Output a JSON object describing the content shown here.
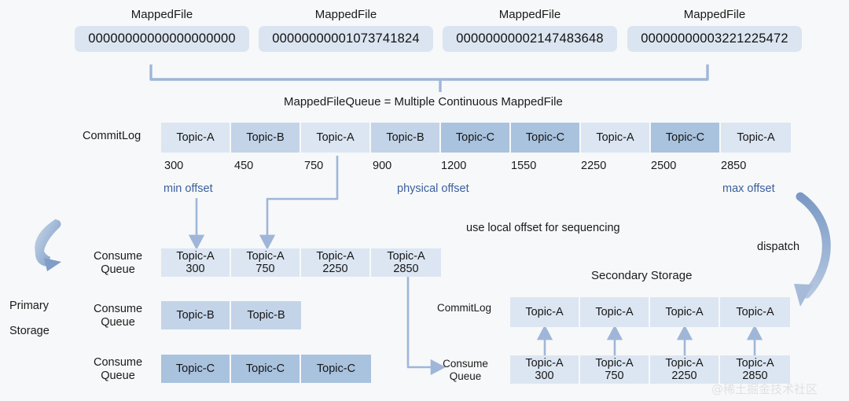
{
  "diagram": {
    "title_caption": "MappedFileQueue = Multiple Continuous MappedFile",
    "mapped_files": [
      {
        "name": "MappedFile",
        "value": "00000000000000000000"
      },
      {
        "name": "MappedFile",
        "value": "00000000001073741824"
      },
      {
        "name": "MappedFile",
        "value": "00000000002147483648"
      },
      {
        "name": "MappedFile",
        "value": "00000000003221225472"
      }
    ],
    "primary": {
      "storage_label_line1": "Primary",
      "storage_label_line2": "Storage",
      "commitlog_label": "CommitLog",
      "commitlog_cells": [
        {
          "topic": "Topic-A",
          "shade": "tA"
        },
        {
          "topic": "Topic-B",
          "shade": "tB"
        },
        {
          "topic": "Topic-A",
          "shade": "tA"
        },
        {
          "topic": "Topic-B",
          "shade": "tB"
        },
        {
          "topic": "Topic-C",
          "shade": "tC"
        },
        {
          "topic": "Topic-C",
          "shade": "tC"
        },
        {
          "topic": "Topic-A",
          "shade": "tA"
        },
        {
          "topic": "Topic-C",
          "shade": "tC"
        },
        {
          "topic": "Topic-A",
          "shade": "tA"
        }
      ],
      "offsets": [
        "300",
        "450",
        "750",
        "900",
        "1200",
        "1550",
        "2250",
        "2500",
        "2850"
      ],
      "min_offset_label": "min offset",
      "physical_offset_label": "physical offset",
      "max_offset_label": "max offset",
      "queues": [
        {
          "label_line1": "Consume",
          "label_line2": "Queue",
          "cells": [
            {
              "topic": "Topic-A",
              "offset": "300",
              "shade": "tA"
            },
            {
              "topic": "Topic-A",
              "offset": "750",
              "shade": "tA"
            },
            {
              "topic": "Topic-A",
              "offset": "2250",
              "shade": "tA"
            },
            {
              "topic": "Topic-A",
              "offset": "2850",
              "shade": "tA"
            }
          ]
        },
        {
          "label_line1": "Consume",
          "label_line2": "Queue",
          "cells": [
            {
              "topic": "Topic-B",
              "offset": "",
              "shade": "tB"
            },
            {
              "topic": "Topic-B",
              "offset": "",
              "shade": "tB"
            }
          ]
        },
        {
          "label_line1": "Consume",
          "label_line2": "Queue",
          "cells": [
            {
              "topic": "Topic-C",
              "offset": "",
              "shade": "tC"
            },
            {
              "topic": "Topic-C",
              "offset": "",
              "shade": "tC"
            },
            {
              "topic": "Topic-C",
              "offset": "",
              "shade": "tC"
            }
          ]
        }
      ]
    },
    "annotations": {
      "sequencing_note": "use local offset for sequencing",
      "dispatch_label": "dispatch"
    },
    "secondary": {
      "title": "Secondary Storage",
      "commitlog_label": "CommitLog",
      "commitlog_cells": [
        {
          "topic": "Topic-A",
          "shade": "tA"
        },
        {
          "topic": "Topic-A",
          "shade": "tA"
        },
        {
          "topic": "Topic-A",
          "shade": "tA"
        },
        {
          "topic": "Topic-A",
          "shade": "tA"
        }
      ],
      "queue_label_line1": "Consume",
      "queue_label_line2": "Queue",
      "queue_cells": [
        {
          "topic": "Topic-A",
          "offset": "300",
          "shade": "tA"
        },
        {
          "topic": "Topic-A",
          "offset": "750",
          "shade": "tA"
        },
        {
          "topic": "Topic-A",
          "offset": "2250",
          "shade": "tA"
        },
        {
          "topic": "Topic-A",
          "offset": "2850",
          "shade": "tA"
        }
      ]
    },
    "watermark": "@稀土掘金技术社区",
    "colors": {
      "background": "#f7f8f9",
      "topic_a": "#dce6f2",
      "topic_b": "#c3d4e9",
      "topic_c": "#a9c2de",
      "pill": "#dbe5f1",
      "connector": "#9fb6d9",
      "accent_text": "#3b5f9e",
      "arc": "#8ba7cd"
    }
  }
}
